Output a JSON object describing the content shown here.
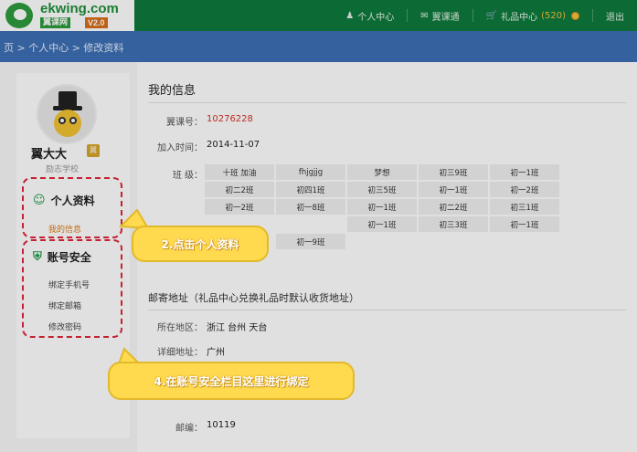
{
  "logo": {
    "name": "ekwing.com",
    "cn": "翼课网",
    "version": "V2.0"
  },
  "nav": {
    "personal": "个人中心",
    "ekwing": "翼课通",
    "gift": "礼品中心",
    "coins": "(520)",
    "logout": "退出"
  },
  "breadcrumb": "页 > 个人中心 > 修改资料",
  "sidebar": {
    "username": "翼大大",
    "badge": "翼",
    "school": "励志学校",
    "profile": {
      "title": "个人资料",
      "items": [
        "我的信息"
      ]
    },
    "security": {
      "title": "账号安全",
      "items": [
        "绑定手机号",
        "绑定邮箱",
        "修改密码"
      ]
    }
  },
  "main": {
    "title": "我的信息",
    "id_label": "翼课号：",
    "id_value": "10276228",
    "join_label": "加入时间：",
    "join_value": "2014-11-07",
    "class_label": "班 级：",
    "classes": [
      "十班 加油",
      "fhjgjjg",
      "梦想",
      "初三9班",
      "初一1班",
      "初二2班",
      "初四1班",
      "初三5班",
      "初一1班",
      "初一2班",
      "初一2班",
      "初一8班",
      "初一1班",
      "初二2班",
      "初三1班",
      "",
      "",
      "初一1班",
      "初三3班",
      "初一1班",
      "",
      "初一9班",
      "",
      "",
      ""
    ],
    "address_title": "邮寄地址（礼品中心兑换礼品时默认收货地址）",
    "region_label": "所在地区：",
    "region_value": "浙江 台州 天台",
    "detail_label": "详细地址：",
    "detail_value": "广州",
    "zip_label": "邮编：",
    "zip_value": "10119"
  },
  "tips": {
    "tip1": "2.点击个人资料",
    "tip2": "4.在账号安全栏目这里进行绑定"
  },
  "colors": {
    "header": "#0e7a3c",
    "bluebar": "#3d6fb6",
    "accent": "#e07a18",
    "dash": "#e0263a",
    "bubble": "#ffd94e"
  }
}
